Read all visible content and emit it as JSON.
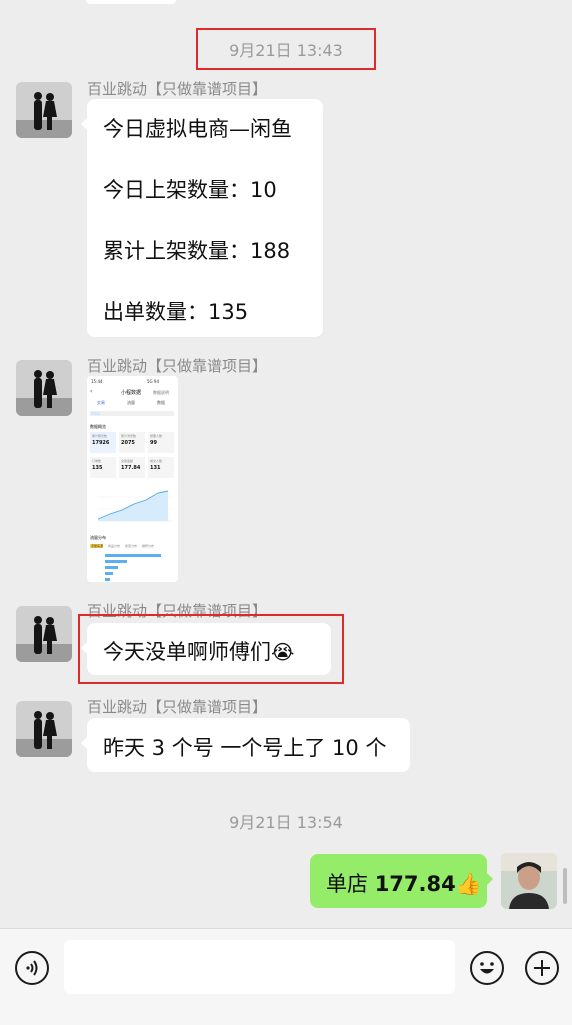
{
  "timestamps": [
    "9月21日 13:43",
    "9月21日 13:54"
  ],
  "messages": [
    {
      "sender": "百业跳动【只做靠谱项目】",
      "lines": [
        "今日虚拟电商—闲鱼",
        "今日上架数量：10",
        "累计上架数量：188",
        "出单数量：135"
      ]
    },
    {
      "sender": "百业跳动【只做靠谱项目】",
      "image": {
        "time": "15:44",
        "status": "5G 94",
        "title": "小程数据",
        "right_link": "数据说明",
        "tabs": [
          "交易",
          "流量",
          "数据"
        ],
        "section_overview": "数据概览",
        "stats": [
          {
            "label": "累计曝光数",
            "value": "17926"
          },
          {
            "label": "累计浏览数",
            "value": "2075"
          },
          {
            "label": "想要人数",
            "value": "99"
          },
          {
            "label": "订单数",
            "value": "135"
          },
          {
            "label": "交易金额",
            "value": "177.84"
          },
          {
            "label": "成交人数",
            "value": "131"
          }
        ],
        "section_dist": "流量分布",
        "dist_tabs": [
          "流量来源",
          "商品分布",
          "搜索分布",
          "推荐分布"
        ]
      }
    },
    {
      "sender": "百业跳动【只做靠谱项目】",
      "text": "今天没单啊师傅们",
      "emoji": "😭"
    },
    {
      "sender": "百业跳动【只做靠谱项目】",
      "text": "昨天 3 个号  一个号上了 10 个"
    }
  ],
  "self_message": {
    "prefix": "单店 ",
    "amount": "177.84",
    "emoji": "👍"
  },
  "colors": {
    "highlight": "#e02a2a",
    "self_bubble": "#95ec69",
    "background": "#ededed",
    "chart_line": "#4fa6e8"
  },
  "input_bar": {
    "voice_icon": "voice-icon",
    "emoji_icon": "emoji-icon",
    "add_icon": "add-icon"
  }
}
